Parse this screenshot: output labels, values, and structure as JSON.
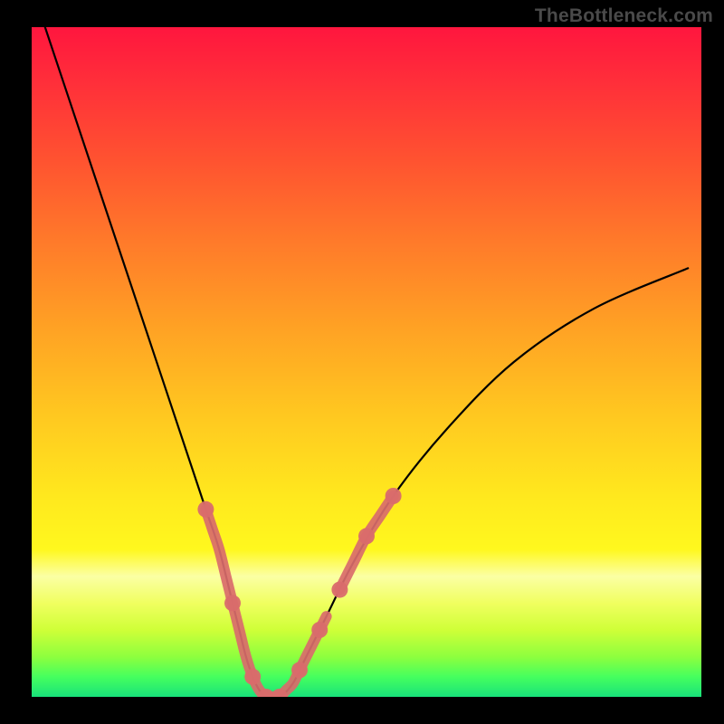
{
  "watermark": "TheBottleneck.com",
  "chart_data": {
    "type": "line",
    "title": "",
    "xlabel": "",
    "ylabel": "",
    "xlim": [
      0,
      100
    ],
    "ylim": [
      0,
      100
    ],
    "grid": false,
    "series": [
      {
        "name": "bottleneck-curve",
        "color": "#000000",
        "x": [
          2,
          6,
          10,
          14,
          18,
          22,
          24,
          26,
          28,
          30,
          31,
          32,
          33,
          34,
          35,
          37,
          39,
          41,
          44,
          48,
          54,
          62,
          72,
          84,
          98
        ],
        "y": [
          100,
          88,
          76,
          64,
          52,
          40,
          34,
          28,
          22,
          14,
          10,
          6,
          3,
          1,
          0,
          0,
          2,
          6,
          12,
          20,
          30,
          40,
          50,
          58,
          64
        ]
      }
    ],
    "highlight": {
      "name": "highlight-segments",
      "color": "#d96b6b",
      "segments": [
        {
          "x": [
            26,
            27,
            28,
            29,
            30,
            31,
            32,
            33,
            34,
            35,
            36,
            37,
            38,
            39,
            40,
            41,
            42,
            43,
            44
          ],
          "y": [
            28,
            25,
            22,
            18,
            14,
            10,
            6,
            3,
            1,
            0,
            0,
            0,
            1,
            2,
            4,
            6,
            8,
            10,
            12
          ]
        },
        {
          "x": [
            46,
            48,
            50,
            52,
            54
          ],
          "y": [
            16,
            20,
            24,
            27,
            30
          ]
        }
      ],
      "dots": {
        "x": [
          26,
          30,
          33,
          35,
          37,
          40,
          43,
          46,
          50,
          54
        ],
        "y": [
          28,
          14,
          3,
          0,
          0,
          4,
          10,
          16,
          24,
          30
        ]
      }
    }
  }
}
